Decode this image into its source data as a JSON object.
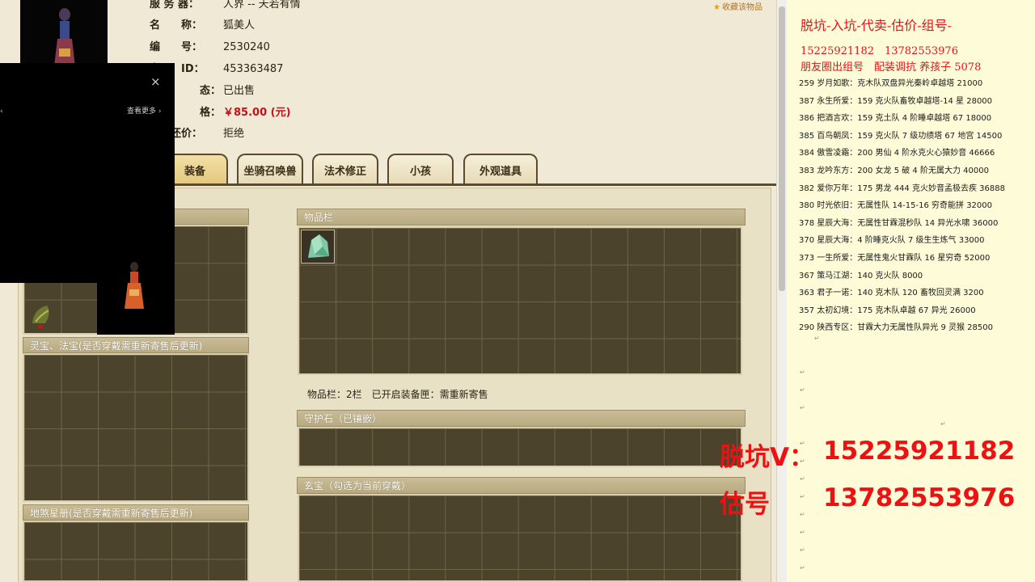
{
  "favorite_label": "收藏该物品",
  "info": [
    {
      "key": "服 务 器：",
      "value": "人界 -- 天若有情"
    },
    {
      "key": "名　　称：",
      "value": "狐美人"
    },
    {
      "key": "编　　号：",
      "value": "2530240"
    },
    {
      "key": "家　　ID：",
      "value": "453363487"
    },
    {
      "key": "态：",
      "value": "已出售"
    },
    {
      "key": "格：",
      "value": "￥85.00 (元)"
    },
    {
      "key": "接受还价：",
      "value": "拒绝"
    }
  ],
  "tabs": [
    {
      "label": "",
      "active": false
    },
    {
      "label": "",
      "active": false
    },
    {
      "label": "装备",
      "active": true
    },
    {
      "label": "坐骑召唤兽",
      "active": false
    },
    {
      "label": "法术修正",
      "active": false
    },
    {
      "label": "小孩",
      "active": false
    },
    {
      "label": "外观道具",
      "active": false
    }
  ],
  "sections": {
    "inventory": "物品栏",
    "inventory_note": "物品栏：2栏　已开启装备匣：需重新寄售",
    "guard_stone": "守护石（已镶嵌）",
    "xuanbao": "玄宝（勾选为当前穿戴）",
    "lingbao": "灵宝、法宝(是否穿戴需重新寄售后更新)",
    "disha": "地煞星册(是否穿戴需重新寄售后更新)"
  },
  "popup": {
    "close": "×",
    "more": "查看更多 ›",
    "dot": "‹"
  },
  "notes": {
    "title": "脱坑-入坑-代卖-估价-组号-",
    "phones": "15225921182　13782553976",
    "slogan": "朋友圈出组号　配装调抗 养孩子 5078",
    "lines": [
      "259 岁月如歌：克木队双盘异光秦岭卓越塔 21000",
      "387 永生所爱：159 克火队畜牧卓越塔-14 星 28000",
      "386 把酒言欢：159 克土队 4 阶睡卓越塔 67 18000",
      "385 百鸟朝凤：159 克火队 7 级功绩塔 67 地宫 14500",
      "384 傲雪凌霜：200 男仙 4 阶水克火心猿妙音 46666",
      "383 龙吟东方：200 女龙 5 破 4 阶无属大力 40000",
      "382 爱你万年：175 男龙 444 克火妙音孟极去疾 36888",
      "380 时光依旧：无属性队 14-15-16 穷奇能拼 32000",
      "378 星辰大海：无属性甘霖混秒队 14 异光水啸 36000",
      "370 星辰大海：4 阶睡克火队 7 级生生炼气 33000",
      "373 一生所爱：无属性鬼火甘霖队 16 星穷奇 52000",
      "367 策马江湖：140 克火队 8000",
      "363 君子一诺：140 克木队 120 畜牧回灵满 3200",
      "357 太初幻境：175 克木队卓越 67 异光 26000",
      "290 陕西专区：甘霖大力无属性队异光 9 灵猴 28500"
    ],
    "return_mark": "↵"
  },
  "overlay": {
    "line1_label": "脱坑V：",
    "line1_phone": "15225921182",
    "line2_label": "估号",
    "line2_phone": "13782553976"
  }
}
